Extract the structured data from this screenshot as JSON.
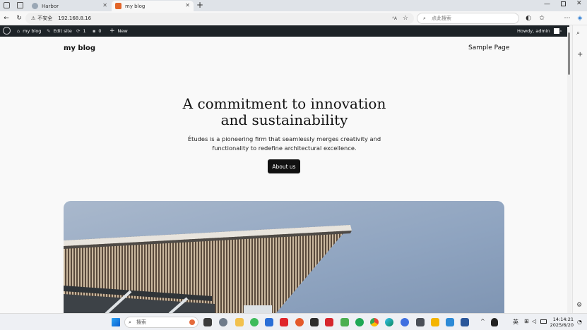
{
  "browser": {
    "tabs": [
      {
        "label": "Harbor",
        "active": false
      },
      {
        "label": "my blog",
        "active": true
      }
    ],
    "security_label": "不安全",
    "url": "192.168.8.16",
    "search_placeholder": "点此搜索"
  },
  "adminbar": {
    "site": "my blog",
    "edit": "Edit site",
    "updates": "1",
    "comments": "0",
    "new": "New",
    "howdy": "Howdy, admin"
  },
  "site": {
    "title": "my blog",
    "nav": [
      "Sample Page"
    ]
  },
  "hero": {
    "title": "A commitment to innovation and sustainability",
    "text": "Études is a pioneering firm that seamlessly merges creativity and functionality to redefine architectural excellence.",
    "button": "About us"
  },
  "taskbar": {
    "search_placeholder": "搜索",
    "ime": "英",
    "time": "14:14:21",
    "date": "2025/6/20"
  },
  "colors": {
    "adminbar": "#1d2327",
    "button": "#111111",
    "sky": "#8fa4c0"
  }
}
